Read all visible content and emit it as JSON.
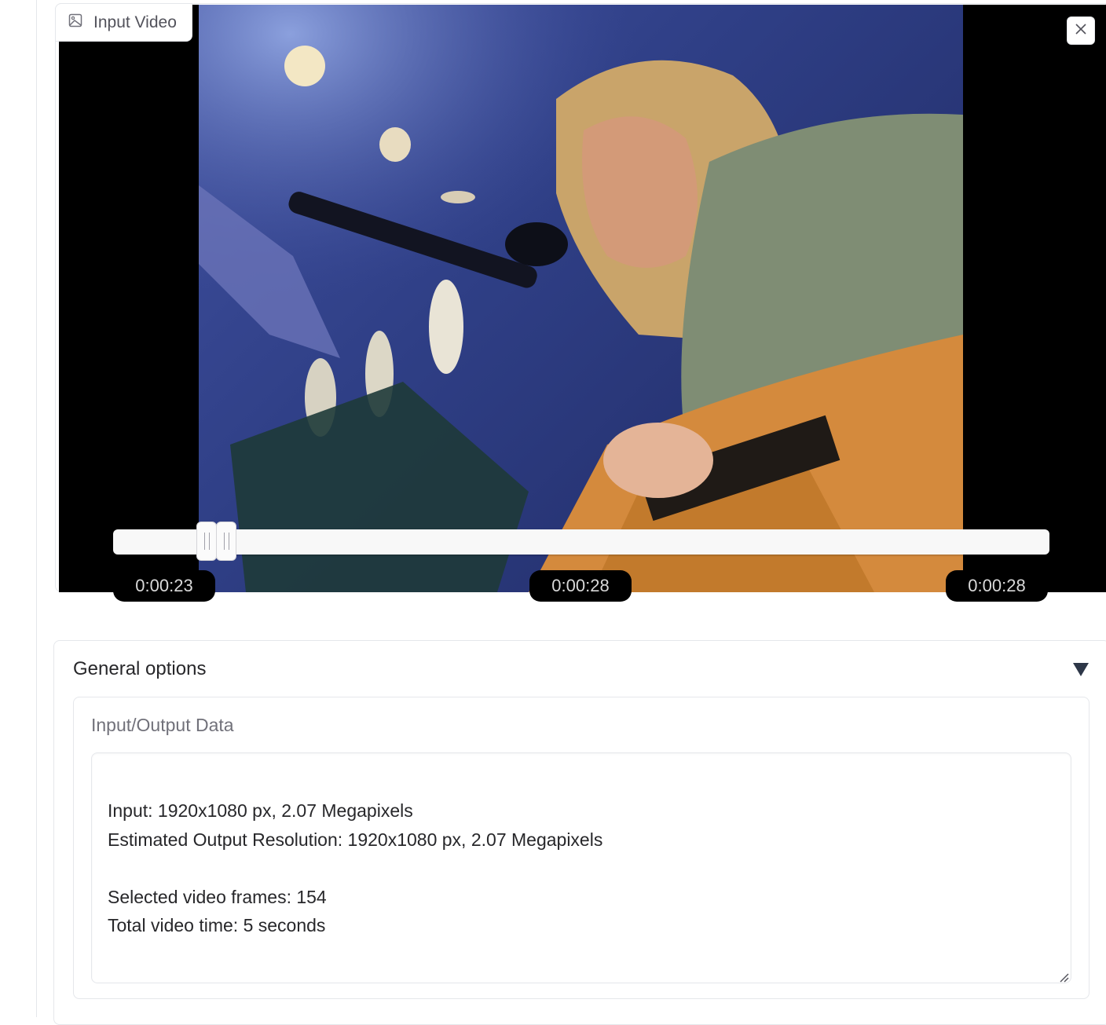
{
  "video": {
    "label": "Input Video",
    "close_symbol": "×",
    "trim": {
      "start_fraction": 0.1,
      "end_fraction": 0.121
    },
    "time_start": "0:00:23",
    "time_current": "0:00:28",
    "time_end": "0:00:28"
  },
  "options": {
    "title": "General options",
    "collapse_icon": "triangle-down-icon",
    "io": {
      "label": "Input/Output Data",
      "lines": [
        "Input: 1920x1080 px, 2.07 Megapixels",
        "Estimated Output Resolution: 1920x1080 px, 2.07 Megapixels",
        "",
        "Selected video frames: 154",
        "Total video time: 5 seconds"
      ]
    }
  }
}
